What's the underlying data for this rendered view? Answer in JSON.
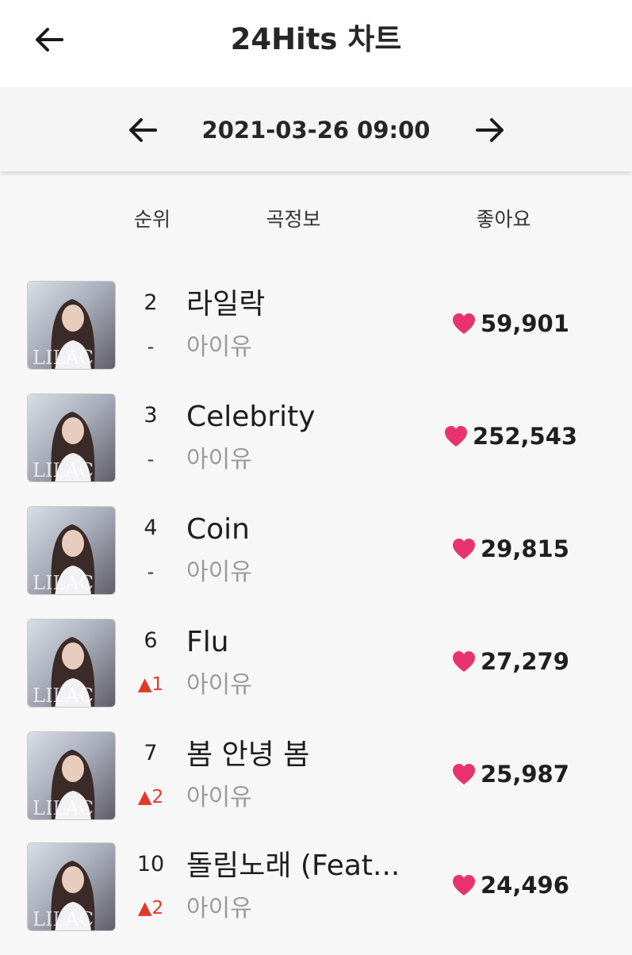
{
  "header": {
    "title": "24Hits 차트"
  },
  "date_nav": {
    "date": "2021-03-26 09:00"
  },
  "columns": {
    "rank": "순위",
    "song": "곡정보",
    "likes": "좋아요"
  },
  "album_art_text": "LILAC",
  "colors": {
    "heart": "#e8336f",
    "rank_up": "#e0392b",
    "artist": "#9b9b9b"
  },
  "songs": [
    {
      "rank": "2",
      "change": "-",
      "title": "라일락",
      "artist": "아이유",
      "likes": "59,901"
    },
    {
      "rank": "3",
      "change": "-",
      "title": "Celebrity",
      "artist": "아이유",
      "likes": "252,543"
    },
    {
      "rank": "4",
      "change": "-",
      "title": "Coin",
      "artist": "아이유",
      "likes": "29,815"
    },
    {
      "rank": "6",
      "change": "▲1",
      "title": "Flu",
      "artist": "아이유",
      "likes": "27,279"
    },
    {
      "rank": "7",
      "change": "▲2",
      "title": "봄 안녕 봄",
      "artist": "아이유",
      "likes": "25,987"
    },
    {
      "rank": "10",
      "change": "▲2",
      "title": "돌림노래 (Feat...",
      "artist": "아이유",
      "likes": "24,496"
    }
  ]
}
